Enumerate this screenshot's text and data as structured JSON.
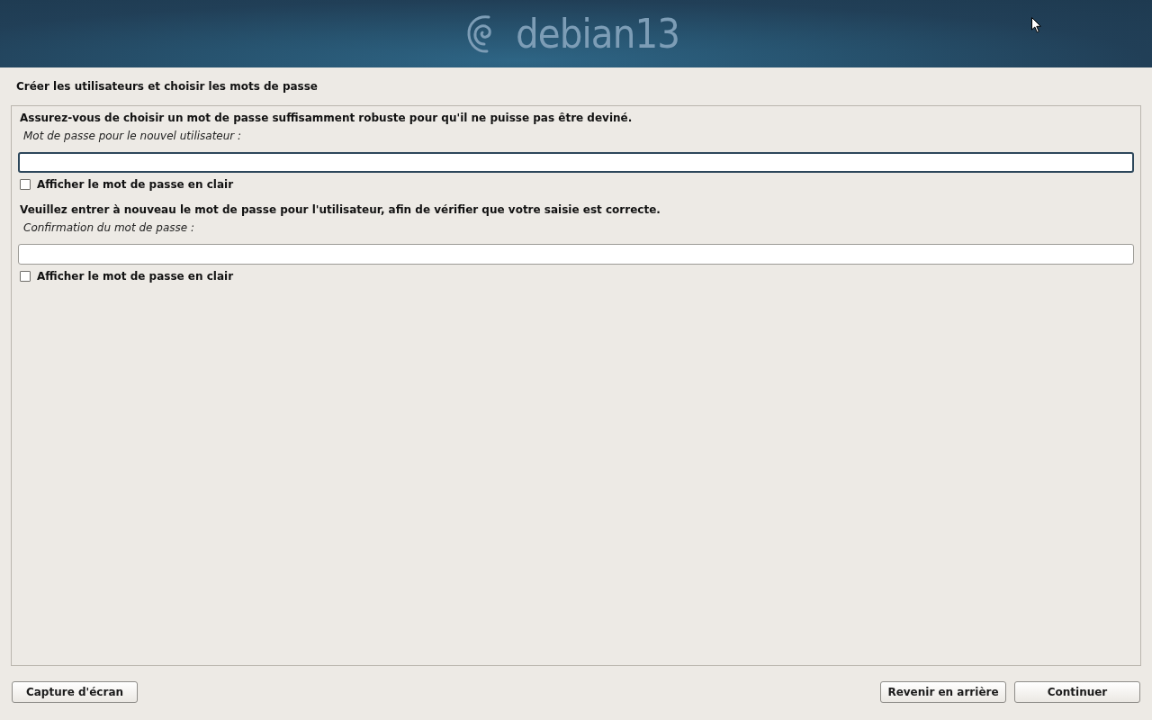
{
  "header": {
    "logo_text": "debian13"
  },
  "title": "Créer les utilisateurs et choisir les mots de passe",
  "questions": [
    {
      "description": "Assurez-vous de choisir un mot de passe suffisamment robuste pour qu'il ne puisse pas être deviné.",
      "field_label": "Mot de passe pour le nouvel utilisateur :",
      "field": {
        "focused": true
      },
      "show_password": {
        "label": "Afficher le mot de passe en clair",
        "checked": false
      }
    },
    {
      "description": "Veuillez entrer à nouveau le mot de passe pour l'utilisateur, afin de vérifier que votre saisie est correcte.",
      "field_label": "Confirmation du mot de passe :",
      "field": {
        "focused": false
      },
      "show_password": {
        "label": "Afficher le mot de passe en clair",
        "checked": false
      }
    }
  ],
  "footer": {
    "left_buttons": [
      {
        "label": "Capture d'écran"
      }
    ],
    "right_buttons": [
      {
        "label": "Revenir en arrière"
      },
      {
        "label": "Continuer"
      }
    ]
  }
}
